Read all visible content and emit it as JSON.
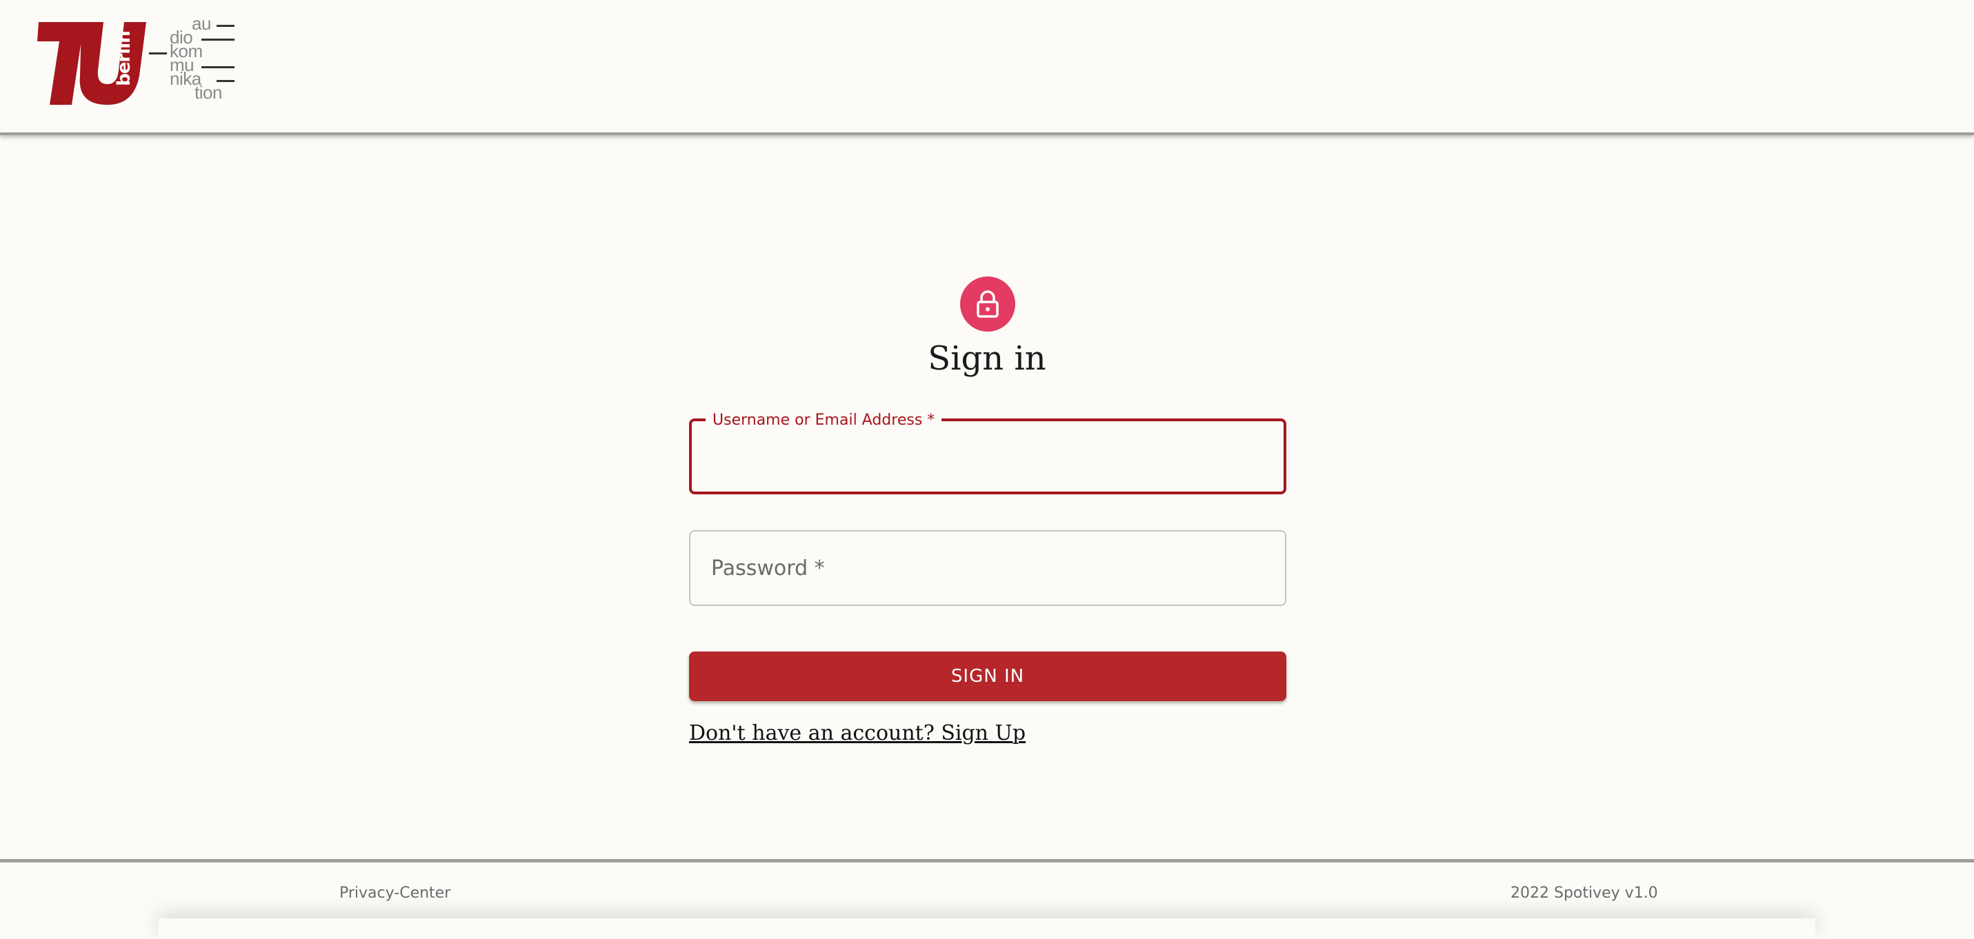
{
  "logo": {
    "name": "TU Berlin audiokommunikation",
    "berlin": "berlin",
    "syllables": [
      "au",
      "dio",
      "kom",
      "mu",
      "nika",
      "tion"
    ]
  },
  "form": {
    "icon": "lock-icon",
    "title": "Sign in",
    "username_label": "Username or Email Address *",
    "username_value": "",
    "password_placeholder": "Password *",
    "password_value": "",
    "submit_label": "SIGN IN",
    "signup_link": "Don't have an account? Sign Up"
  },
  "footer": {
    "privacy": "Privacy-Center",
    "version": "2022 Spotivey v1.0"
  },
  "colors": {
    "accent": "#b5272a",
    "avatar": "#e33b62",
    "focus": "#a6161d",
    "background": "#fcfbf8"
  }
}
